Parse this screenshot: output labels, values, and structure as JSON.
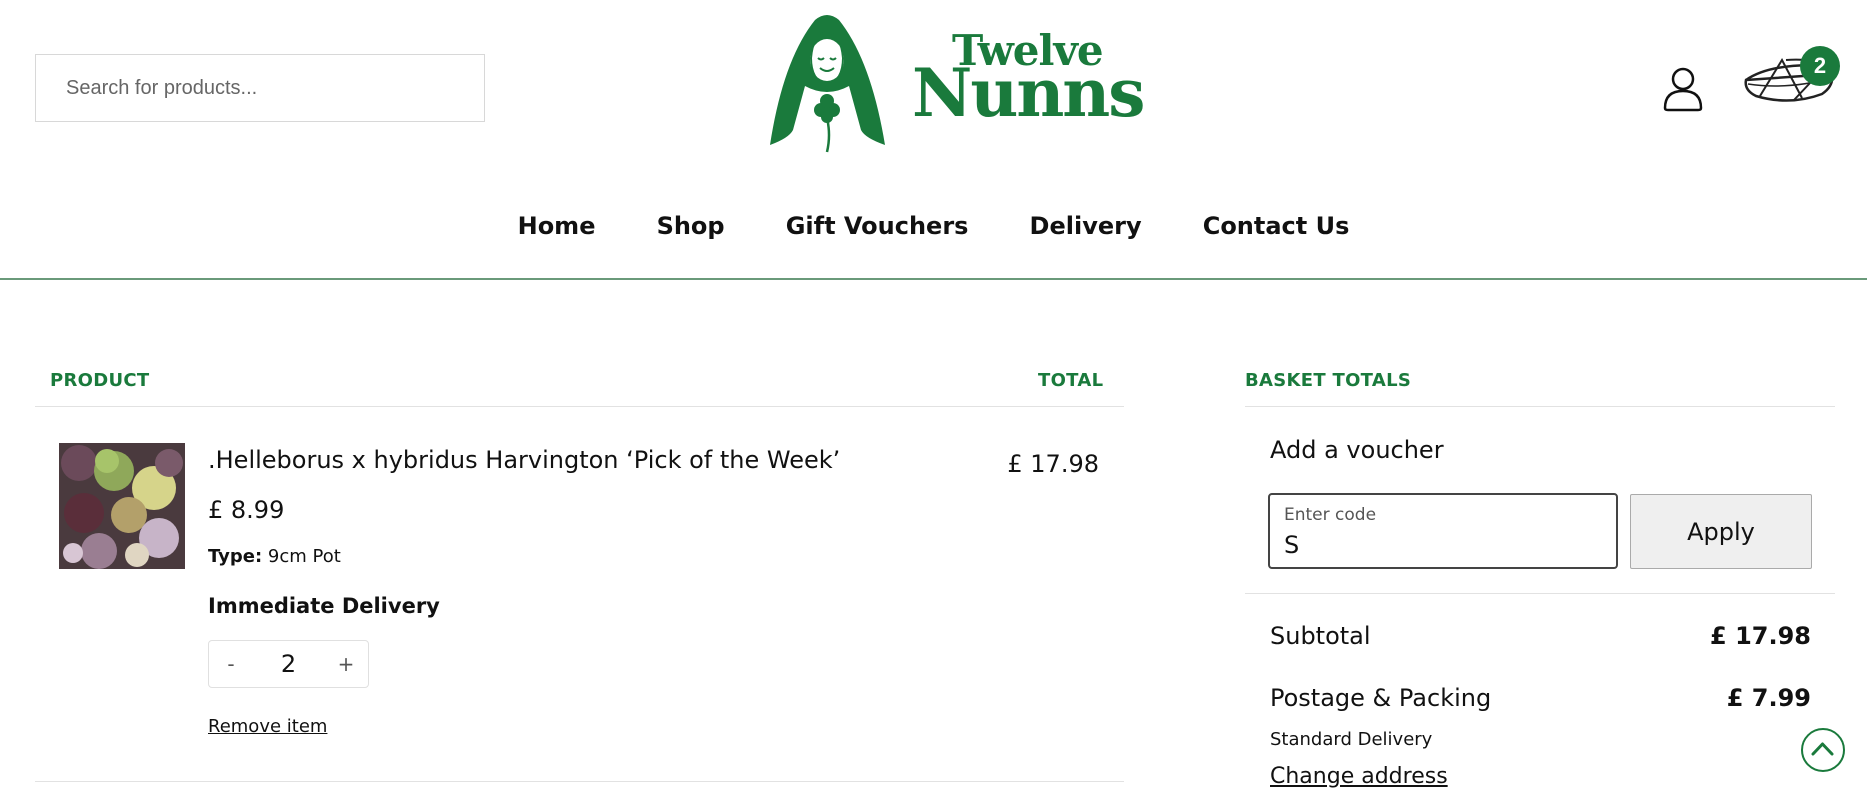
{
  "search": {
    "placeholder": "Search for products..."
  },
  "logo": {
    "line1": "Twelve",
    "line2": "Nunns",
    "brand_color": "#1a7a3c"
  },
  "header": {
    "basket_count": "2"
  },
  "nav": {
    "items": [
      {
        "label": "Home"
      },
      {
        "label": "Shop"
      },
      {
        "label": "Gift Vouchers"
      },
      {
        "label": "Delivery"
      },
      {
        "label": "Contact Us"
      }
    ]
  },
  "cart": {
    "headers": {
      "product": "PRODUCT",
      "total": "TOTAL"
    },
    "item": {
      "name": ".Helleborus x hybridus Harvington ‘Pick of the Week’",
      "price": "£ 8.99",
      "type_label": "Type:",
      "type_value": "9cm Pot",
      "delivery": "Immediate Delivery",
      "quantity": "2",
      "minus": "-",
      "plus": "+",
      "remove": "Remove item",
      "total": "£ 17.98"
    }
  },
  "totals": {
    "header": "BASKET TOTALS",
    "voucher_heading": "Add a voucher",
    "code_label": "Enter code",
    "code_value": "S",
    "apply": "Apply",
    "subtotal_label": "Subtotal",
    "subtotal_value": "£ 17.98",
    "postage_label": "Postage & Packing",
    "postage_value": "£ 7.99",
    "delivery_method": "Standard Delivery",
    "change_address": "Change address"
  },
  "icons": {
    "account": "user-icon",
    "basket": "basket-icon",
    "scroll_top": "chevron-up-icon"
  }
}
